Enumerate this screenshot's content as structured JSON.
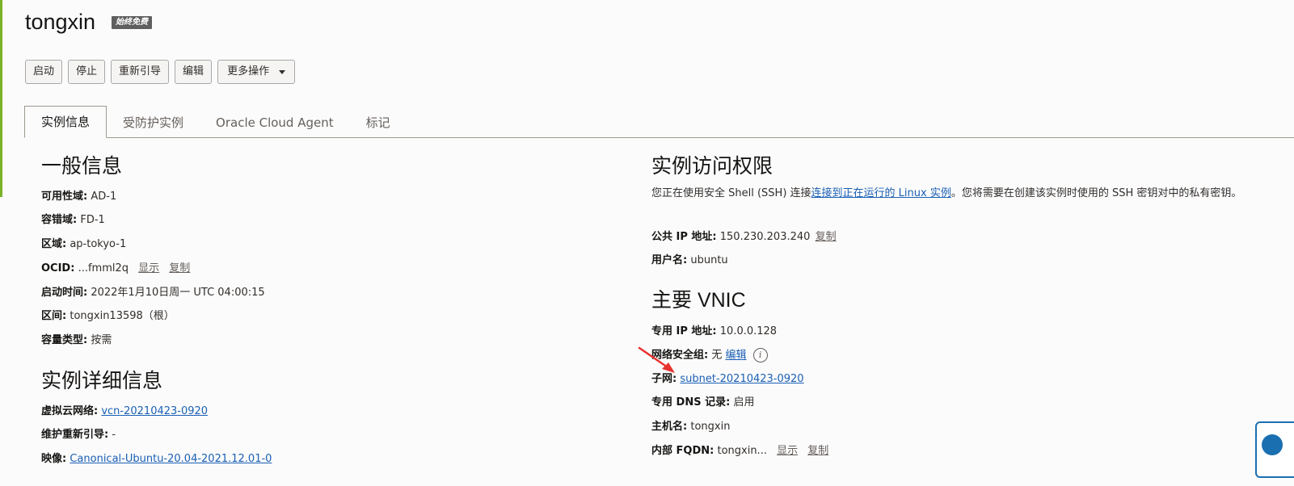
{
  "header": {
    "title": "tongxin",
    "badge": "始终免费"
  },
  "toolbar": {
    "start": "启动",
    "stop": "停止",
    "reboot": "重新引导",
    "edit": "编辑",
    "more": "更多操作"
  },
  "tabs": [
    "实例信息",
    "受防护实例",
    "Oracle Cloud Agent",
    "标记"
  ],
  "general": {
    "heading": "一般信息",
    "ad_label": "可用性域:",
    "ad_value": "AD-1",
    "fd_label": "容错域:",
    "fd_value": "FD-1",
    "region_label": "区域:",
    "region_value": "ap-tokyo-1",
    "ocid_label": "OCID:",
    "ocid_value": "...fmml2q",
    "ocid_show": "显示",
    "ocid_copy": "复制",
    "launch_label": "启动时间:",
    "launch_value": "2022年1月10日周一 UTC 04:00:15",
    "compartment_label": "区间:",
    "compartment_value": "tongxin13598（根）",
    "capacity_label": "容量类型:",
    "capacity_value": "按需"
  },
  "details": {
    "heading": "实例详细信息",
    "vcn_label": "虚拟云网络:",
    "vcn_value": "vcn-20210423-0920",
    "maint_label": "维护重新引导:",
    "maint_value": "-",
    "image_label": "映像:",
    "image_value": "Canonical-Ubuntu-20.04-2021.12.01-0"
  },
  "access": {
    "heading": "实例访问权限",
    "text_before": "您正在使用安全 Shell (SSH) 连接",
    "link": "连接到正在运行的 Linux 实例",
    "text_after": "。您将需要在创建该实例时使用的 SSH 密钥对中的私有密钥。",
    "public_ip_label": "公共 IP 地址:",
    "public_ip_value": "150.230.203.240",
    "public_ip_copy": "复制",
    "username_label": "用户名:",
    "username_value": "ubuntu"
  },
  "vnic": {
    "heading": "主要 VNIC",
    "private_ip_label": "专用 IP 地址:",
    "private_ip_value": "10.0.0.128",
    "nsg_label": "网络安全组:",
    "nsg_value": "无",
    "nsg_edit": "编辑",
    "info_icon_glyph": "i",
    "subnet_label": "子网:",
    "subnet_value": "subnet-20210423-0920",
    "dns_label": "专用 DNS 记录:",
    "dns_value": "启用",
    "hostname_label": "主机名:",
    "hostname_value": "tongxin",
    "fqdn_label": "内部 FQDN:",
    "fqdn_value": "tongxin...",
    "fqdn_show": "显示",
    "fqdn_copy": "复制"
  },
  "colors": {
    "accent_green": "#7ab32a",
    "link_blue": "#1a5fb4",
    "annotation_arrow": "#e8322f"
  }
}
